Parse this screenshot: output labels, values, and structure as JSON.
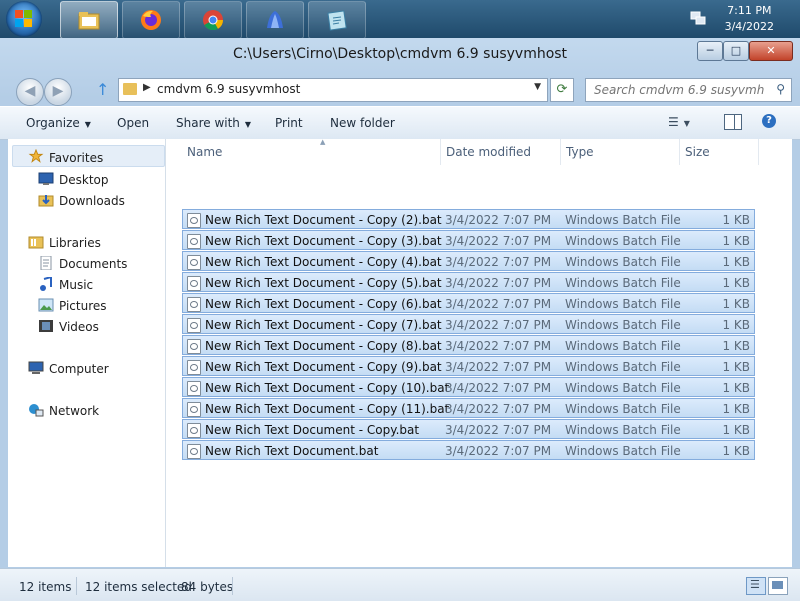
{
  "taskbar": {
    "buttons": [
      {
        "name": "windows-explorer",
        "active": true
      },
      {
        "name": "firefox"
      },
      {
        "name": "chrome"
      },
      {
        "name": "app-4"
      },
      {
        "name": "app-5"
      }
    ],
    "clock": {
      "time": "7:11 PM",
      "date": "3/4/2022"
    }
  },
  "window": {
    "title": "C:\\Users\\Cirno\\Desktop\\cmdvm 6.9 susyvmhost",
    "buttons": {
      "minimize": "─",
      "maximize": "□",
      "close": "✕"
    }
  },
  "address_bar": {
    "path": "cmdvm 6.9 susyvmhost",
    "search_placeholder": "Search cmdvm 6.9 susyvmhost"
  },
  "toolbar": {
    "organize": "Organize",
    "open": "Open",
    "share_with": "Share with",
    "print": "Print",
    "new_folder": "New folder"
  },
  "nav_pane": {
    "favorites": "Favorites",
    "desktop": "Desktop",
    "downloads": "Downloads",
    "libraries": "Libraries",
    "documents": "Documents",
    "music": "Music",
    "pictures": "Pictures",
    "videos": "Videos",
    "computer": "Computer",
    "network": "Network"
  },
  "columns": {
    "name": "Name",
    "date": "Date modified",
    "type": "Type",
    "size": "Size"
  },
  "files": [
    {
      "name": "New Rich Text Document - Copy (2).bat",
      "date": "3/4/2022 7:07 PM",
      "type": "Windows Batch File",
      "size": "1 KB"
    },
    {
      "name": "New Rich Text Document - Copy (3).bat",
      "date": "3/4/2022 7:07 PM",
      "type": "Windows Batch File",
      "size": "1 KB"
    },
    {
      "name": "New Rich Text Document - Copy (4).bat",
      "date": "3/4/2022 7:07 PM",
      "type": "Windows Batch File",
      "size": "1 KB"
    },
    {
      "name": "New Rich Text Document - Copy (5).bat",
      "date": "3/4/2022 7:07 PM",
      "type": "Windows Batch File",
      "size": "1 KB"
    },
    {
      "name": "New Rich Text Document - Copy (6).bat",
      "date": "3/4/2022 7:07 PM",
      "type": "Windows Batch File",
      "size": "1 KB"
    },
    {
      "name": "New Rich Text Document - Copy (7).bat",
      "date": "3/4/2022 7:07 PM",
      "type": "Windows Batch File",
      "size": "1 KB"
    },
    {
      "name": "New Rich Text Document - Copy (8).bat",
      "date": "3/4/2022 7:07 PM",
      "type": "Windows Batch File",
      "size": "1 KB"
    },
    {
      "name": "New Rich Text Document - Copy (9).bat",
      "date": "3/4/2022 7:07 PM",
      "type": "Windows Batch File",
      "size": "1 KB"
    },
    {
      "name": "New Rich Text Document - Copy (10).bat",
      "date": "3/4/2022 7:07 PM",
      "type": "Windows Batch File",
      "size": "1 KB"
    },
    {
      "name": "New Rich Text Document - Copy (11).bat",
      "date": "3/4/2022 7:07 PM",
      "type": "Windows Batch File",
      "size": "1 KB"
    },
    {
      "name": "New Rich Text Document - Copy.bat",
      "date": "3/4/2022 7:07 PM",
      "type": "Windows Batch File",
      "size": "1 KB"
    },
    {
      "name": "New Rich Text Document.bat",
      "date": "3/4/2022 7:07 PM",
      "type": "Windows Batch File",
      "size": "1 KB"
    }
  ],
  "status": {
    "items": "12 items",
    "selected": "12 items selected",
    "size": "84 bytes"
  },
  "colors": {
    "selection": "#cce0f7",
    "accent": "#3b8ad8"
  }
}
